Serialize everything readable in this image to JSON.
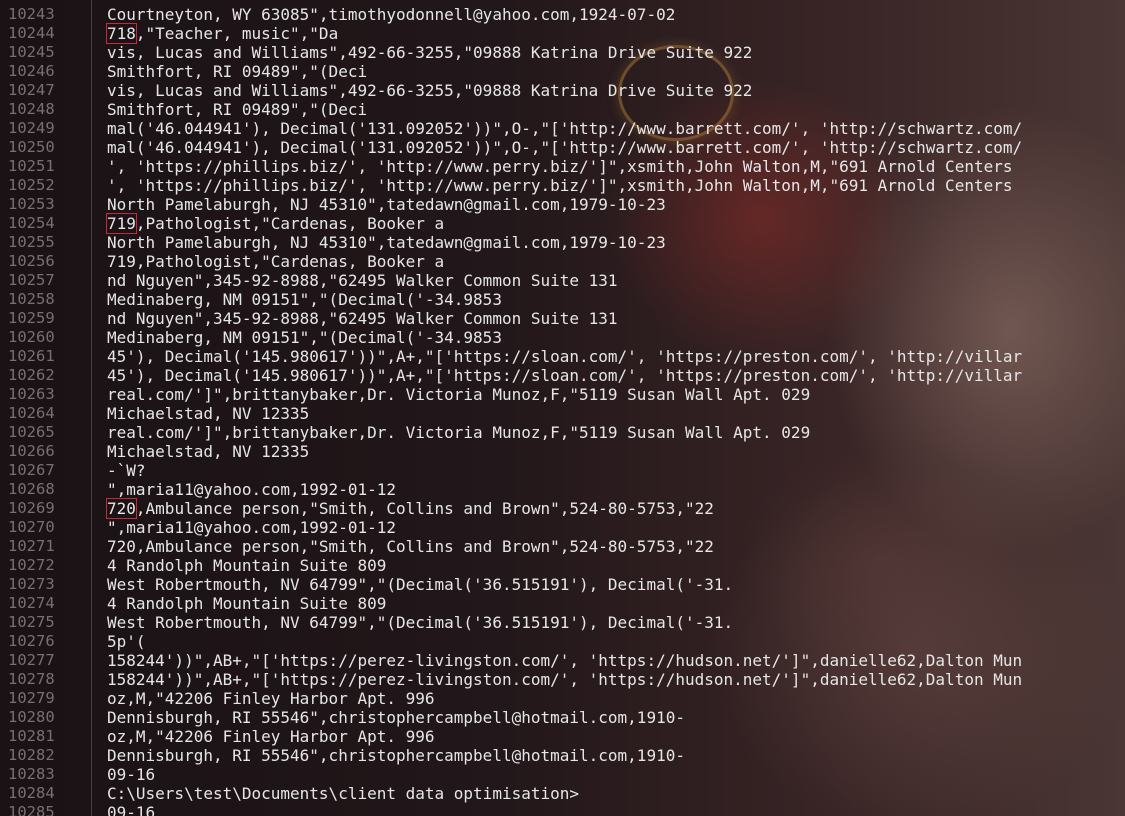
{
  "terminal": {
    "highlight_color": "#c8283a",
    "lines": [
      {
        "n": "10243",
        "t": "Courtneyton, WY 63085\",timothyodonnell@yahoo.com,1924-07-02"
      },
      {
        "n": "10244",
        "t": "718,\"Teacher, music\",\"Da",
        "hl": "718"
      },
      {
        "n": "10245",
        "t": "vis, Lucas and Williams\",492-66-3255,\"09888 Katrina Drive Suite 922"
      },
      {
        "n": "10246",
        "t": "Smithfort, RI 09489\",\"(Deci"
      },
      {
        "n": "10247",
        "t": "vis, Lucas and Williams\",492-66-3255,\"09888 Katrina Drive Suite 922"
      },
      {
        "n": "10248",
        "t": "Smithfort, RI 09489\",\"(Deci"
      },
      {
        "n": "10249",
        "t": "mal('46.044941'), Decimal('131.092052'))\",O-,\"['http://www.barrett.com/', 'http://schwartz.com/"
      },
      {
        "n": "10250",
        "t": "mal('46.044941'), Decimal('131.092052'))\",O-,\"['http://www.barrett.com/', 'http://schwartz.com/"
      },
      {
        "n": "10251",
        "t": "', 'https://phillips.biz/', 'http://www.perry.biz/']\",xsmith,John Walton,M,\"691 Arnold Centers"
      },
      {
        "n": "10252",
        "t": "', 'https://phillips.biz/', 'http://www.perry.biz/']\",xsmith,John Walton,M,\"691 Arnold Centers"
      },
      {
        "n": "10253",
        "t": "North Pamelaburgh, NJ 45310\",tatedawn@gmail.com,1979-10-23"
      },
      {
        "n": "10254",
        "t": "719,Pathologist,\"Cardenas, Booker a",
        "hl": "719"
      },
      {
        "n": "10255",
        "t": "North Pamelaburgh, NJ 45310\",tatedawn@gmail.com,1979-10-23"
      },
      {
        "n": "10256",
        "t": "719,Pathologist,\"Cardenas, Booker a"
      },
      {
        "n": "10257",
        "t": "nd Nguyen\",345-92-8988,\"62495 Walker Common Suite 131"
      },
      {
        "n": "10258",
        "t": "Medinaberg, NM 09151\",\"(Decimal('-34.9853"
      },
      {
        "n": "10259",
        "t": "nd Nguyen\",345-92-8988,\"62495 Walker Common Suite 131"
      },
      {
        "n": "10260",
        "t": "Medinaberg, NM 09151\",\"(Decimal('-34.9853"
      },
      {
        "n": "10261",
        "t": "45'), Decimal('145.980617'))\",A+,\"['https://sloan.com/', 'https://preston.com/', 'http://villar"
      },
      {
        "n": "10262",
        "t": "45'), Decimal('145.980617'))\",A+,\"['https://sloan.com/', 'https://preston.com/', 'http://villar"
      },
      {
        "n": "10263",
        "t": "real.com/']\",brittanybaker,Dr. Victoria Munoz,F,\"5119 Susan Wall Apt. 029"
      },
      {
        "n": "10264",
        "t": "Michaelstad, NV 12335"
      },
      {
        "n": "10265",
        "t": "real.com/']\",brittanybaker,Dr. Victoria Munoz,F,\"5119 Susan Wall Apt. 029"
      },
      {
        "n": "10266",
        "t": "Michaelstad, NV 12335"
      },
      {
        "n": "10267",
        "t": "-`W?"
      },
      {
        "n": "10268",
        "t": "\",maria11@yahoo.com,1992-01-12"
      },
      {
        "n": "10269",
        "t": "720,Ambulance person,\"Smith, Collins and Brown\",524-80-5753,\"22",
        "hl": "720"
      },
      {
        "n": "10270",
        "t": "\",maria11@yahoo.com,1992-01-12"
      },
      {
        "n": "10271",
        "t": "720,Ambulance person,\"Smith, Collins and Brown\",524-80-5753,\"22"
      },
      {
        "n": "10272",
        "t": "4 Randolph Mountain Suite 809"
      },
      {
        "n": "10273",
        "t": "West Robertmouth, NV 64799\",\"(Decimal('36.515191'), Decimal('-31."
      },
      {
        "n": "10274",
        "t": "4 Randolph Mountain Suite 809"
      },
      {
        "n": "10275",
        "t": "West Robertmouth, NV 64799\",\"(Decimal('36.515191'), Decimal('-31."
      },
      {
        "n": "10276",
        "t": "5p'("
      },
      {
        "n": "10277",
        "t": "158244'))\",AB+,\"['https://perez-livingston.com/', 'https://hudson.net/']\",danielle62,Dalton Mun"
      },
      {
        "n": "10278",
        "t": "158244'))\",AB+,\"['https://perez-livingston.com/', 'https://hudson.net/']\",danielle62,Dalton Mun"
      },
      {
        "n": "10279",
        "t": "oz,M,\"42206 Finley Harbor Apt. 996"
      },
      {
        "n": "10280",
        "t": "Dennisburgh, RI 55546\",christophercampbell@hotmail.com,1910-"
      },
      {
        "n": "10281",
        "t": "oz,M,\"42206 Finley Harbor Apt. 996"
      },
      {
        "n": "10282",
        "t": "Dennisburgh, RI 55546\",christophercampbell@hotmail.com,1910-"
      },
      {
        "n": "10283",
        "t": "09-16"
      },
      {
        "n": "10284",
        "t": "C:\\Users\\test\\Documents\\client data optimisation>"
      },
      {
        "n": "10285",
        "t": "09-16"
      }
    ]
  }
}
